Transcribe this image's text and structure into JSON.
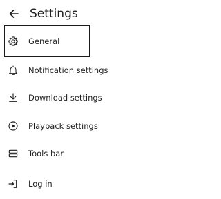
{
  "header": {
    "back_icon": "arrow-left-icon",
    "title": "Settings"
  },
  "menu": {
    "items": [
      {
        "label": "General",
        "icon": "gear-icon",
        "focused": true
      },
      {
        "label": "Notification settings",
        "icon": "bell-icon"
      },
      {
        "label": "Download settings",
        "icon": "download-icon"
      },
      {
        "label": "Playback settings",
        "icon": "play-circle-icon"
      },
      {
        "label": "Tools bar",
        "icon": "toolbar-icon"
      },
      {
        "label": "Log in",
        "icon": "login-icon"
      }
    ]
  },
  "colors": {
    "background": "#ffffff",
    "text": "#1f1f1f",
    "focus_border": "#1a1a1a"
  }
}
